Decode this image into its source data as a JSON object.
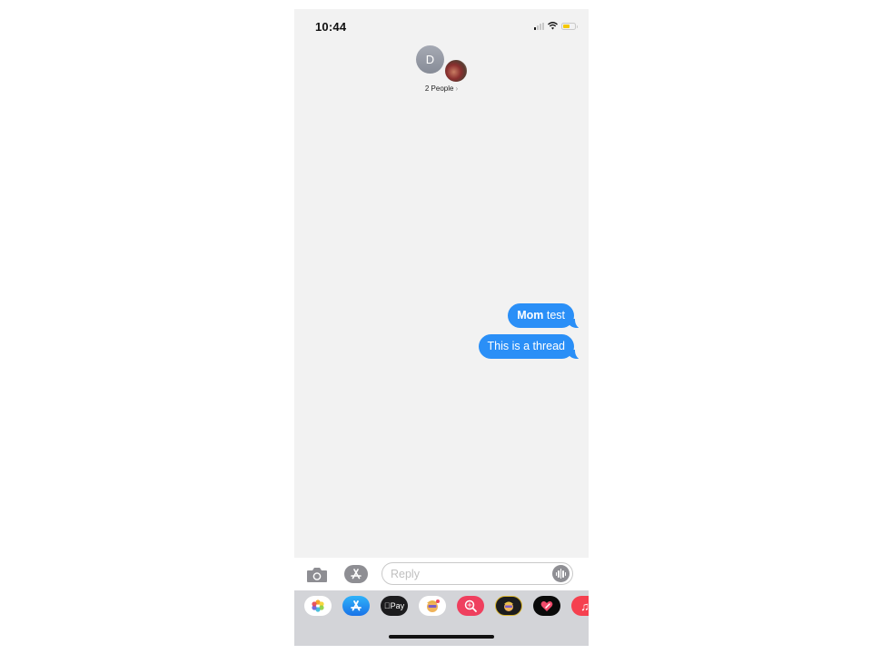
{
  "status_bar": {
    "time": "10:44",
    "signal_bars_on": 1,
    "signal_bars_total": 4,
    "wifi_icon": "wifi-icon",
    "battery_level": 0.55,
    "battery_color": "#f5c800"
  },
  "header": {
    "avatar_initial": "D",
    "group_label": "2 People",
    "chevron": "›"
  },
  "messages": [
    {
      "sender": "me",
      "bold_text": "Mom",
      "text": " test"
    },
    {
      "sender": "me",
      "bold_text": "",
      "text": "This is a thread"
    }
  ],
  "colors": {
    "bubble_blue": "#2a8ff7",
    "background": "#f2f2f2",
    "drawer": "#d3d4d8"
  },
  "input_bar": {
    "placeholder": "Reply",
    "value": "",
    "camera_icon": "camera-icon",
    "apps_icon": "app-store-icon",
    "audio_icon": "audio-waveform-icon"
  },
  "app_drawer": [
    {
      "name": "Photos",
      "icon": "photos-icon"
    },
    {
      "name": "App Store",
      "icon": "app-store-icon",
      "glyph": "A"
    },
    {
      "name": "Apple Pay",
      "icon": "apple-pay-icon",
      "glyph": "Pay"
    },
    {
      "name": "Memoji Stickers",
      "icon": "memoji-stickers-icon"
    },
    {
      "name": "Images Search",
      "icon": "image-search-icon"
    },
    {
      "name": "Animoji",
      "icon": "animoji-icon"
    },
    {
      "name": "Digital Touch",
      "icon": "digital-touch-icon"
    },
    {
      "name": "Music",
      "icon": "music-icon",
      "glyph": "♫"
    }
  ]
}
